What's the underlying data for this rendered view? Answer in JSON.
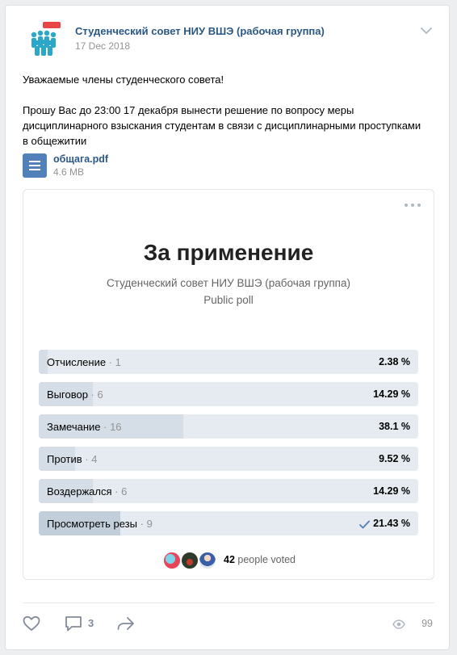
{
  "post": {
    "group_name": "Студенческий совет НИУ ВШЭ (рабочая группа)",
    "date": "17 Dec 2018",
    "avatar_icon": "group-logo-icon",
    "text_line1": "Уважаемые члены студенческого совета!",
    "text_line2": "Прошу Вас до 23:00 17 декабря вынести решение по вопросу меры дисциплинарного взыскания студентам в связи с дисциплинарными проступками в общежитии"
  },
  "attachment": {
    "name": "общага.pdf",
    "size": "4.6 MB",
    "icon": "document-icon"
  },
  "poll": {
    "title": "За применение",
    "author": "Студенческий совет НИУ ВШЭ (рабочая группа)",
    "type": "Public poll",
    "answers": [
      {
        "label": "Отчисление",
        "count": "1",
        "percent": "2.38 %",
        "fraction": 0.0238,
        "chosen": false
      },
      {
        "label": "Выговор",
        "count": "6",
        "percent": "14.29 %",
        "fraction": 0.1429,
        "chosen": false
      },
      {
        "label": "Замечание",
        "count": "16",
        "percent": "38.1 %",
        "fraction": 0.381,
        "chosen": false
      },
      {
        "label": "Против",
        "count": "4",
        "percent": "9.52 %",
        "fraction": 0.0952,
        "chosen": false
      },
      {
        "label": "Воздержался",
        "count": "6",
        "percent": "14.29 %",
        "fraction": 0.1429,
        "chosen": false
      },
      {
        "label": "Просмотреть резы",
        "count": "9",
        "percent": "21.43 %",
        "fraction": 0.2143,
        "chosen": true
      }
    ],
    "voters_count": "42",
    "voters_suffix": "people voted"
  },
  "actions": {
    "like_icon": "heart-icon",
    "comment_icon": "comment-icon",
    "comments_count": "3",
    "share_icon": "share-icon",
    "views_icon": "eye-icon",
    "views_count": "99"
  },
  "colors": {
    "link": "#2a5885",
    "bar_bg": "#e5ebf1",
    "bar_fill": "#d5dde6",
    "bar_fill_chosen": "#c2cfdb",
    "accent": "#5181b8"
  }
}
